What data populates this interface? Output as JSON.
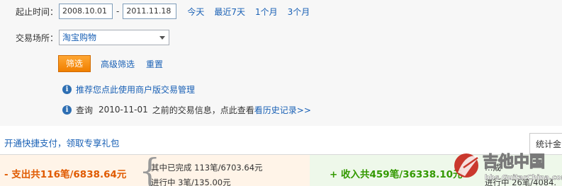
{
  "filter": {
    "date_label": "起止时间：",
    "start_date": "2008.10.01",
    "date_separator": "-",
    "end_date": "2011.11.18",
    "quick_ranges": [
      "今天",
      "最近7天",
      "1个月",
      "3个月"
    ],
    "market_label": "交易场所：",
    "market_value": "淘宝购物",
    "filter_button": "筛选",
    "advanced_filter": "高级筛选",
    "reset": "重置",
    "tip_recommend": "推荐您点此使用商户版交易管理",
    "tip_query_prefix": "查询",
    "tip_query_date": "2010-11-01",
    "tip_query_middle": "之前的交易信息，点此查看",
    "tip_query_link": "看历史记录>>"
  },
  "promo": {
    "link": "开通快捷支付，领取专享礼包",
    "stats_tab": "统计金"
  },
  "summary": {
    "expense_total": "- 支出共116笔/6838.64元",
    "expense_completed": "其中已完成  113笔/6703.64元",
    "expense_in_progress": "进行中  3笔/135.00元",
    "income_total": "+ 收入共459笔/36338.10元",
    "income_completed": "…成",
    "income_in_progress": "进行中  26笔/4084."
  },
  "watermark": {
    "text": "吉他中国",
    "url": "bbs.GuitarChina.com"
  },
  "colors": {
    "link": "#1960b5",
    "button_orange": "#f07f00",
    "expense": "#e05a00",
    "income": "#339900"
  }
}
